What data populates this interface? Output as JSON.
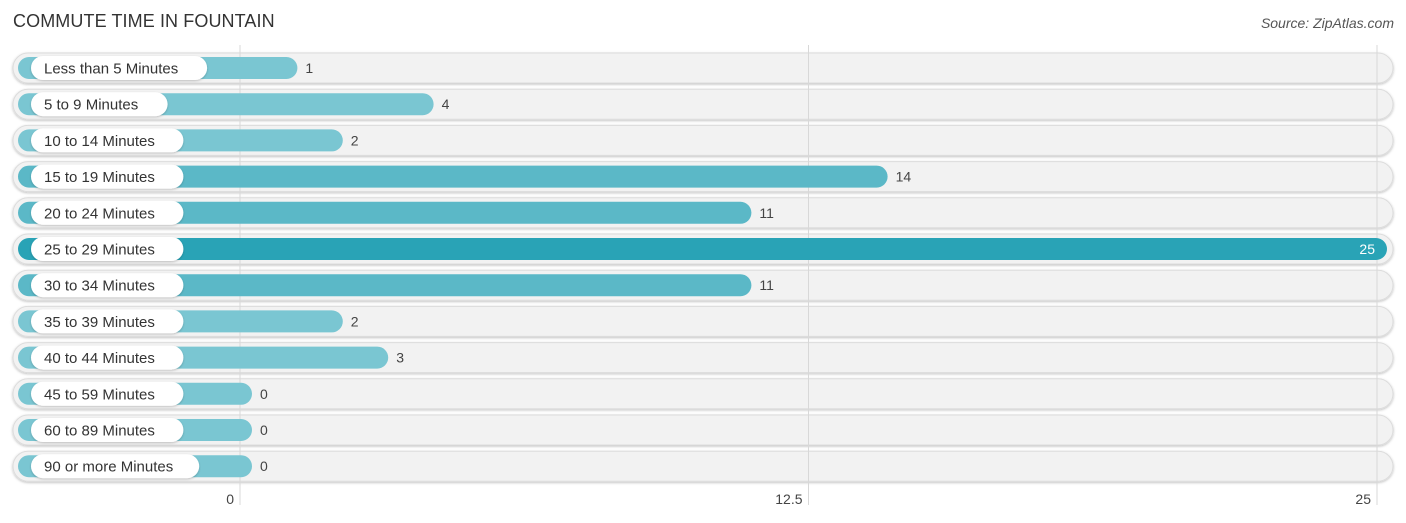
{
  "chart_data": {
    "type": "bar",
    "orientation": "horizontal",
    "title": "COMMUTE TIME IN FOUNTAIN",
    "source": "Source: ZipAtlas.com",
    "categories": [
      "Less than 5 Minutes",
      "5 to 9 Minutes",
      "10 to 14 Minutes",
      "15 to 19 Minutes",
      "20 to 24 Minutes",
      "25 to 29 Minutes",
      "30 to 34 Minutes",
      "35 to 39 Minutes",
      "40 to 44 Minutes",
      "45 to 59 Minutes",
      "60 to 89 Minutes",
      "90 or more Minutes"
    ],
    "values": [
      1,
      4,
      2,
      14,
      11,
      25,
      11,
      2,
      3,
      0,
      0,
      0
    ],
    "xlim": [
      0,
      25
    ],
    "xticks": [
      0,
      12.5,
      25
    ],
    "xtick_labels": [
      "0",
      "12.5",
      "25"
    ],
    "xlabel": "",
    "ylabel": "",
    "grid": true,
    "legend": "none",
    "colors": {
      "bar": "#7ac6d2",
      "bar_mid": "#5bb8c7",
      "bar_max": "#29a3b6",
      "track": "#f2f2f2",
      "grid": "#d8d8d8"
    }
  }
}
